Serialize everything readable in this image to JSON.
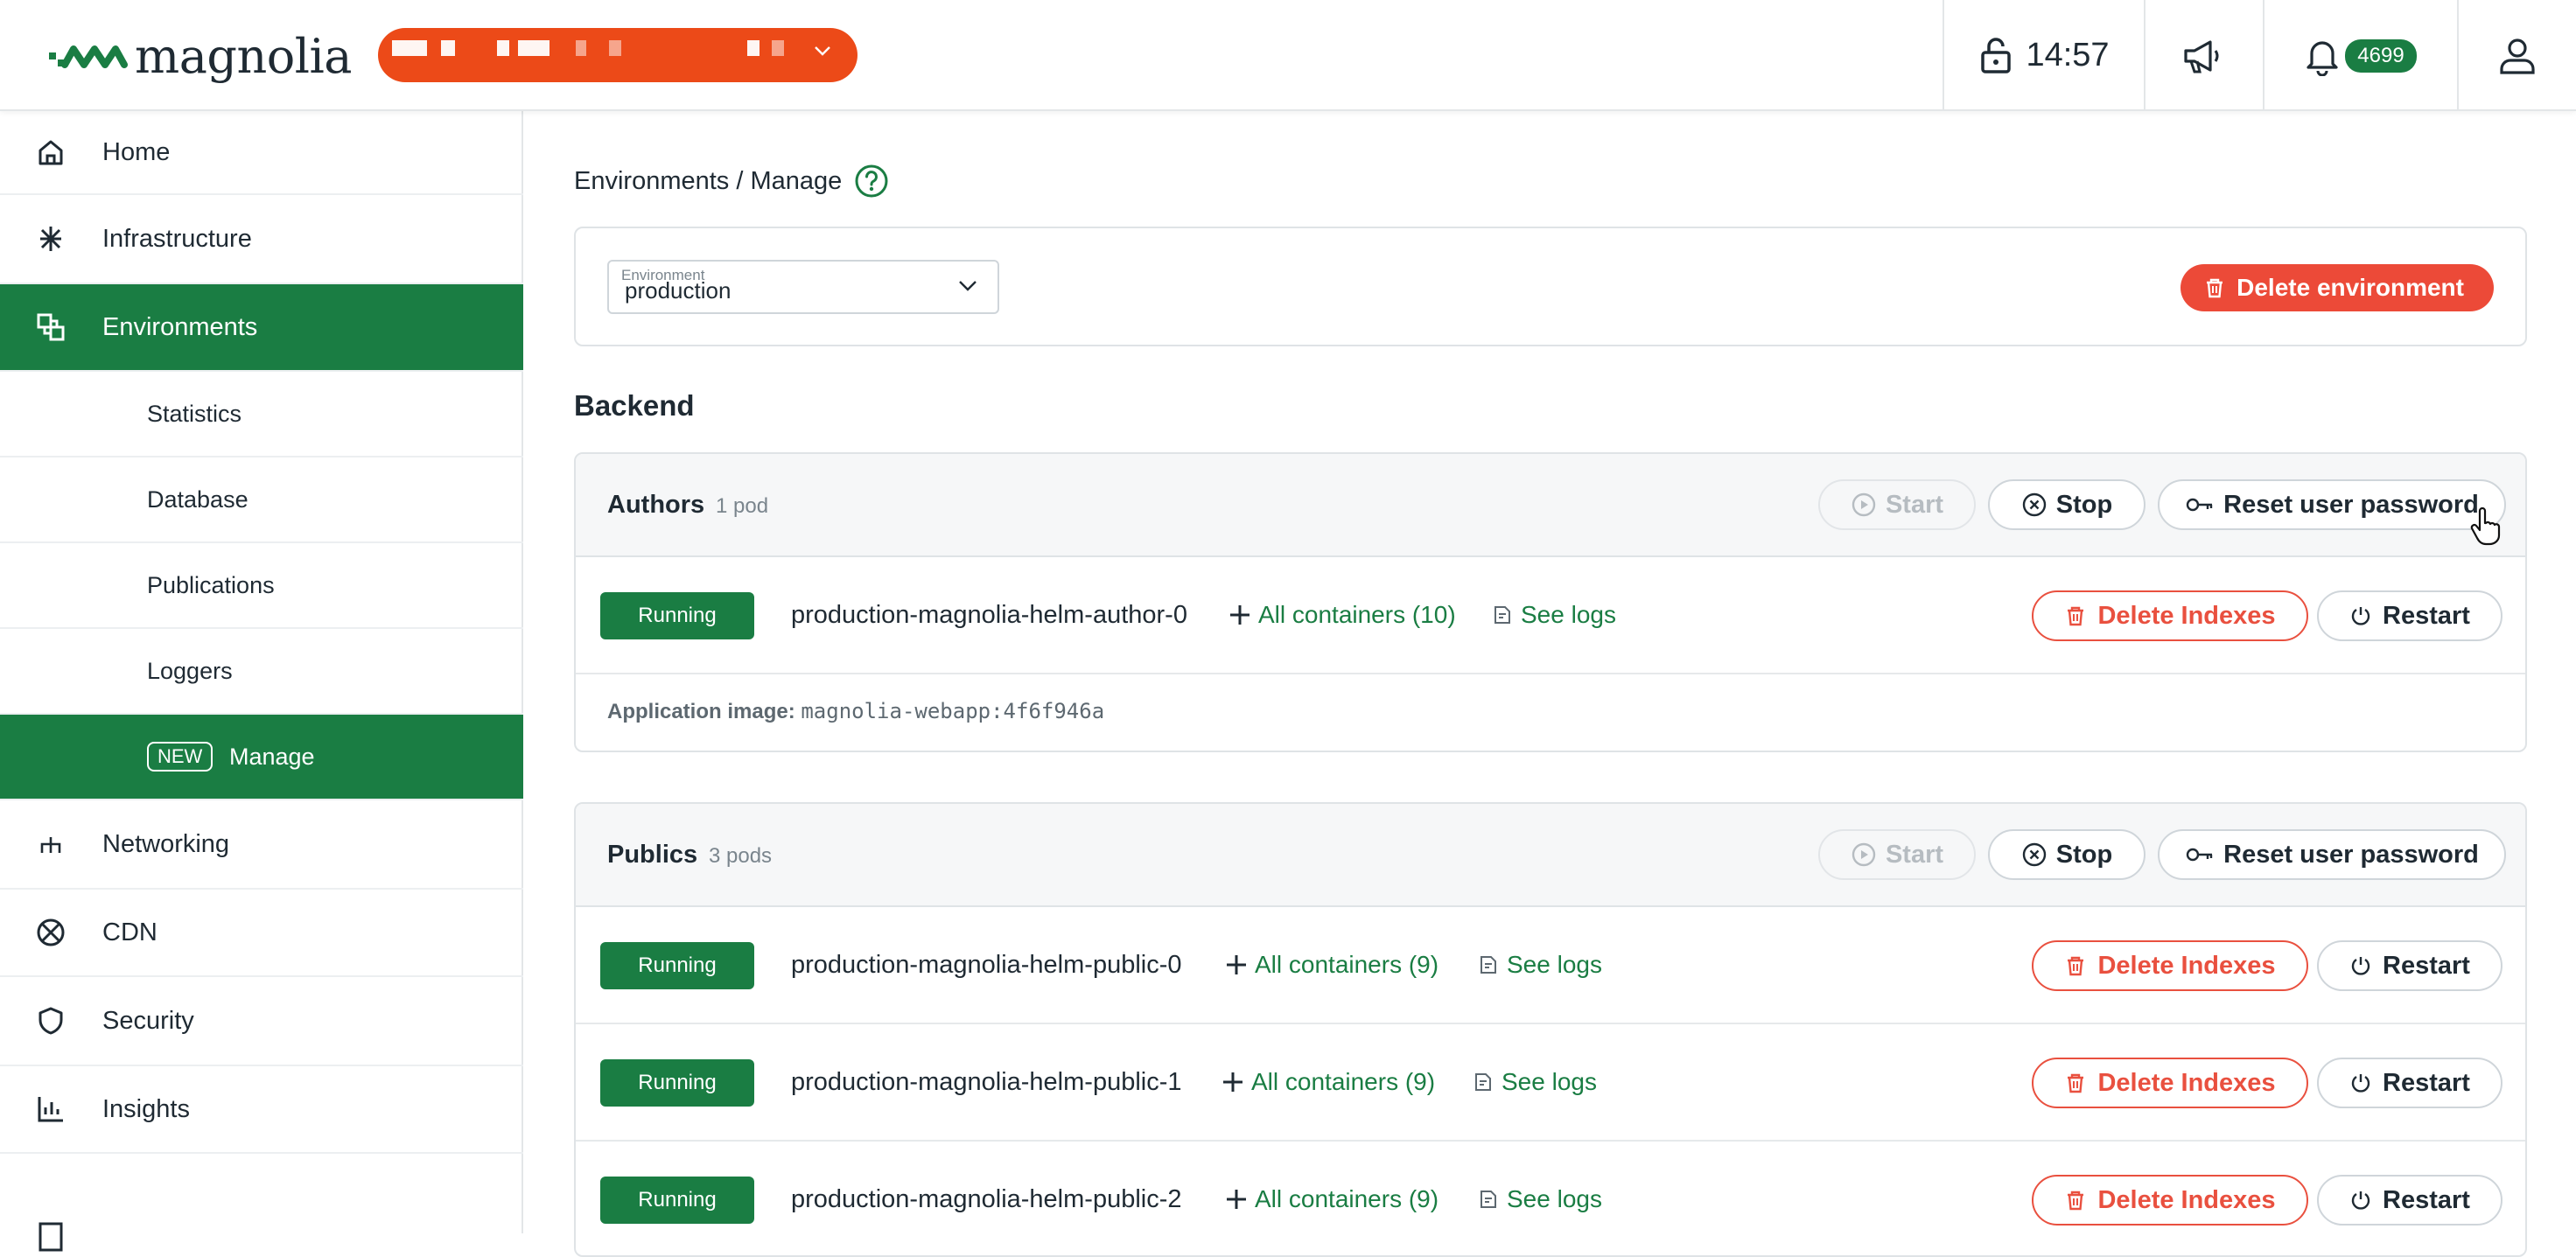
{
  "brand": {
    "name": "magnolia",
    "accent": "#1a7d43",
    "org_pill_color": "#ec4a18"
  },
  "topbar": {
    "time": "14:57",
    "notification_count": "4699"
  },
  "sidebar": {
    "items": [
      {
        "label": "Home",
        "icon": "home-icon"
      },
      {
        "label": "Infrastructure",
        "icon": "infrastructure-icon"
      },
      {
        "label": "Environments",
        "icon": "environments-icon"
      },
      {
        "label": "Statistics"
      },
      {
        "label": "Database"
      },
      {
        "label": "Publications"
      },
      {
        "label": "Loggers"
      },
      {
        "label": "Manage",
        "tag": "NEW"
      },
      {
        "label": "Networking",
        "icon": "networking-icon"
      },
      {
        "label": "CDN",
        "icon": "cdn-icon"
      },
      {
        "label": "Security",
        "icon": "shield-icon"
      },
      {
        "label": "Insights",
        "icon": "insights-icon"
      }
    ]
  },
  "main": {
    "breadcrumb": "Environments / Manage",
    "env_select": {
      "label": "Environment",
      "value": "production"
    },
    "delete_env_label": "Delete environment",
    "section_title": "Backend",
    "buttons": {
      "start": "Start",
      "stop": "Stop",
      "reset": "Reset user password",
      "delete_indexes": "Delete Indexes",
      "restart": "Restart",
      "see_logs": "See logs"
    },
    "groups": [
      {
        "name": "Authors",
        "pods": "1 pod",
        "rows": [
          {
            "status": "Running",
            "pod": "production-magnolia-helm-author-0",
            "containers": "All containers (10)"
          }
        ],
        "app_image_label": "Application image:",
        "app_image_value": "magnolia-webapp:4f6f946a"
      },
      {
        "name": "Publics",
        "pods": "3 pods",
        "rows": [
          {
            "status": "Running",
            "pod": "production-magnolia-helm-public-0",
            "containers": "All containers (9)"
          },
          {
            "status": "Running",
            "pod": "production-magnolia-helm-public-1",
            "containers": "All containers (9)"
          },
          {
            "status": "Running",
            "pod": "production-magnolia-helm-public-2",
            "containers": "All containers (9)"
          }
        ]
      }
    ]
  }
}
